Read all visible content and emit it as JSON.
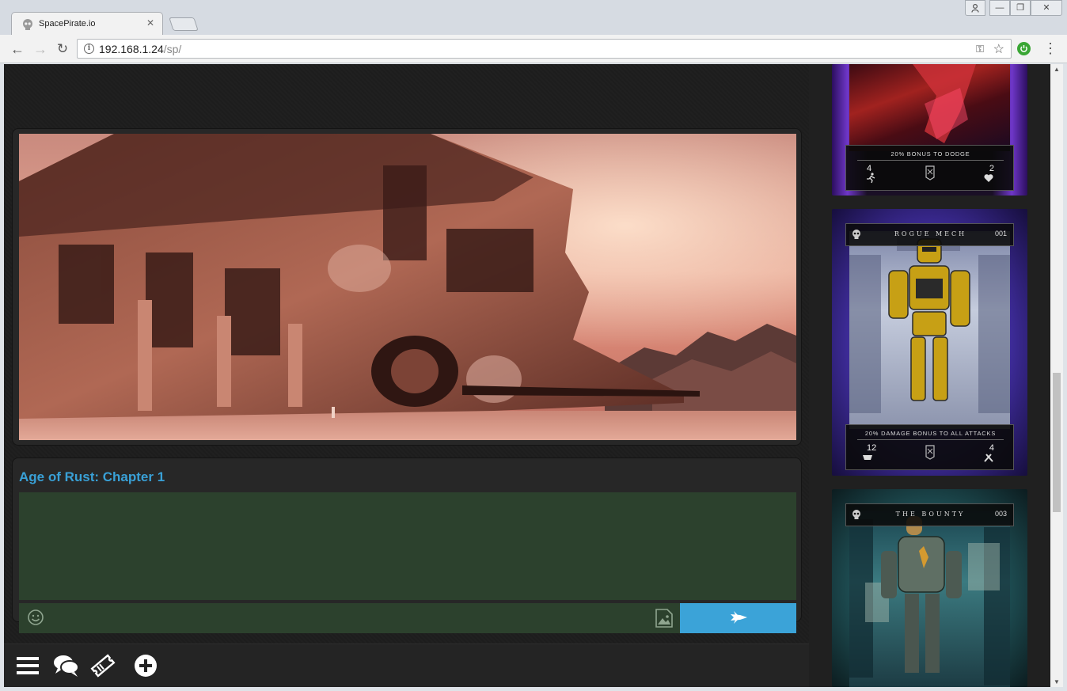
{
  "browser": {
    "tab_title": "SpacePirate.io",
    "tab_close": "✕",
    "url_host": "192.168.1.24",
    "url_path": "/sp/",
    "info_glyph": "i",
    "back_glyph": "←",
    "forward_glyph": "→",
    "reload_glyph": "↻",
    "star_glyph": "☆",
    "key_glyph": "⚿",
    "menu_glyph": "⋮",
    "minimize_glyph": "—",
    "maximize_glyph": "❐",
    "close_glyph": "✕",
    "profile_glyph": "👤"
  },
  "story": {
    "title": "Age of Rust: Chapter 1"
  },
  "chat": {
    "send_icon": "ship-icon",
    "emoji_icon": "smiley-icon",
    "image_icon": "image-icon"
  },
  "nav": {
    "icons": [
      "menu-icon",
      "chat-icon",
      "ticket-icon",
      "add-icon"
    ]
  },
  "cards": [
    {
      "name": "",
      "number": "",
      "bonus": "20% BONUS TO DODGE",
      "stat_left": "4",
      "stat_right": "2"
    },
    {
      "name": "ROGUE MECH",
      "number": "001",
      "bonus": "20% DAMAGE BONUS TO ALL ATTACKS",
      "stat_left": "12",
      "stat_right": "4"
    },
    {
      "name": "THE BOUNTY",
      "number": "003",
      "bonus": "",
      "stat_left": "",
      "stat_right": ""
    }
  ],
  "colors": {
    "accent_blue": "#39a0d6",
    "send_button": "#3ba3d8",
    "chat_green": "#2c412d",
    "extension_green": "#3aa635"
  }
}
